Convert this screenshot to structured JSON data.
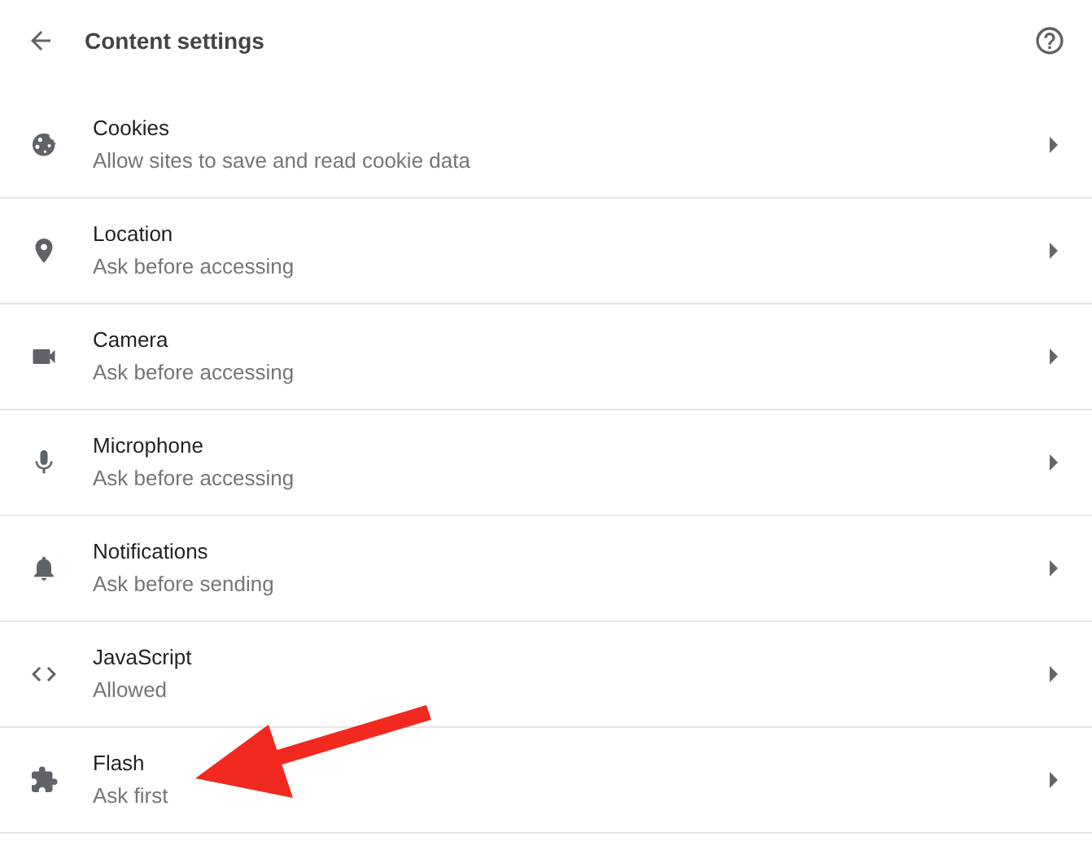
{
  "header": {
    "title": "Content settings"
  },
  "items": [
    {
      "kind": "cookies",
      "title": "Cookies",
      "subtitle": "Allow sites to save and read cookie data"
    },
    {
      "kind": "location",
      "title": "Location",
      "subtitle": "Ask before accessing"
    },
    {
      "kind": "camera",
      "title": "Camera",
      "subtitle": "Ask before accessing"
    },
    {
      "kind": "microphone",
      "title": "Microphone",
      "subtitle": "Ask before accessing"
    },
    {
      "kind": "notifications",
      "title": "Notifications",
      "subtitle": "Ask before sending"
    },
    {
      "kind": "javascript",
      "title": "JavaScript",
      "subtitle": "Allowed"
    },
    {
      "kind": "flash",
      "title": "Flash",
      "subtitle": "Ask first"
    }
  ]
}
